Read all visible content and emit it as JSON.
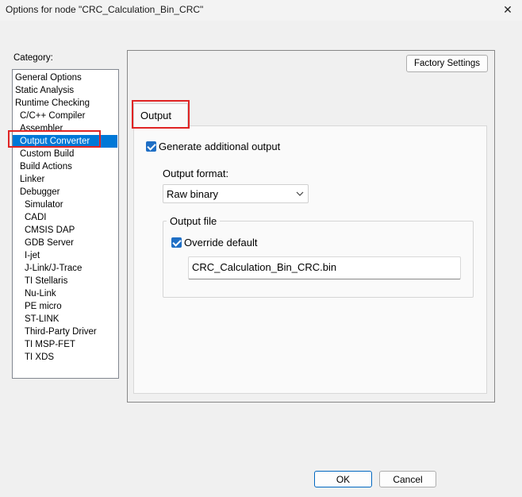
{
  "window": {
    "title": "Options for node \"CRC_Calculation_Bin_CRC\"",
    "close_glyph": "✕"
  },
  "category": {
    "label": "Category:",
    "items": [
      {
        "label": "General Options",
        "level": 0
      },
      {
        "label": "Static Analysis",
        "level": 0
      },
      {
        "label": "Runtime Checking",
        "level": 0
      },
      {
        "label": "C/C++ Compiler",
        "level": 1
      },
      {
        "label": "Assembler",
        "level": 1
      },
      {
        "label": "Output Converter",
        "level": 1,
        "selected": true
      },
      {
        "label": "Custom Build",
        "level": 1
      },
      {
        "label": "Build Actions",
        "level": 1
      },
      {
        "label": "Linker",
        "level": 1
      },
      {
        "label": "Debugger",
        "level": 1
      },
      {
        "label": "Simulator",
        "level": 2
      },
      {
        "label": "CADI",
        "level": 2
      },
      {
        "label": "CMSIS DAP",
        "level": 2
      },
      {
        "label": "GDB Server",
        "level": 2
      },
      {
        "label": "I-jet",
        "level": 2
      },
      {
        "label": "J-Link/J-Trace",
        "level": 2
      },
      {
        "label": "TI Stellaris",
        "level": 2
      },
      {
        "label": "Nu-Link",
        "level": 2
      },
      {
        "label": "PE micro",
        "level": 2
      },
      {
        "label": "ST-LINK",
        "level": 2
      },
      {
        "label": "Third-Party Driver",
        "level": 2
      },
      {
        "label": "TI MSP-FET",
        "level": 2
      },
      {
        "label": "TI XDS",
        "level": 2
      }
    ]
  },
  "panel": {
    "factory_settings_label": "Factory Settings",
    "tab_label": "Output",
    "generate_output": {
      "label": "Generate additional output",
      "checked": true
    },
    "output_format": {
      "label": "Output format:",
      "value": "Raw binary"
    },
    "output_file": {
      "group_title": "Output file",
      "override_default": {
        "label": "Override default",
        "checked": true
      },
      "filename": "CRC_Calculation_Bin_CRC.bin"
    }
  },
  "buttons": {
    "ok": "OK",
    "cancel": "Cancel"
  },
  "colors": {
    "selection": "#0078d7",
    "checkbox": "#1f6fc5",
    "highlight_box": "#e02424"
  }
}
